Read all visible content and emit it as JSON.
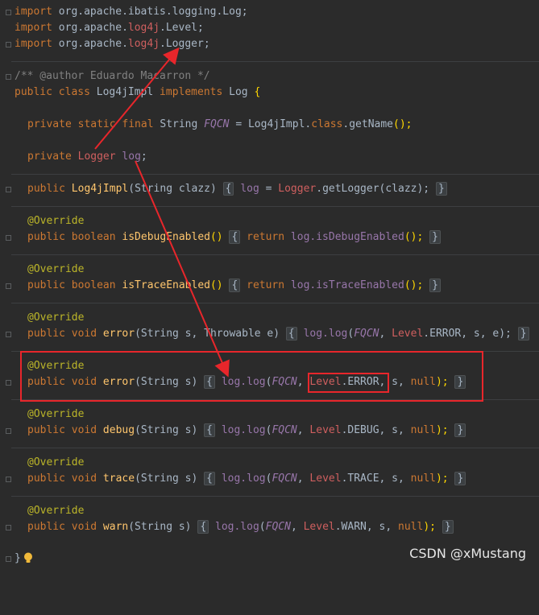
{
  "imports": [
    {
      "kw": "import",
      "pkg": "org.apache.ibatis.logging.",
      "cls": "Log",
      "red": "",
      "tail": ";"
    },
    {
      "kw": "import",
      "pkg": "org.apache.",
      "cls": "",
      "red": "log4j",
      "tail": ".Level;"
    },
    {
      "kw": "import",
      "pkg": "org.apache.",
      "cls": "",
      "red": "log4j",
      "tail": ".Logger;"
    }
  ],
  "comment": "/** @author Eduardo Macarron */",
  "class_decl": {
    "kw1": "public",
    "kw2": "class",
    "name": "Log4jImpl",
    "kw3": "implements",
    "iface": "Log",
    "brace": "{"
  },
  "field1": {
    "mods": "private static final",
    "type": "String",
    "name": "FQCN",
    "eq": "=",
    "value": "Log4jImpl.",
    "kwc": "class",
    "call": ".getName",
    "tail": "();"
  },
  "field2": {
    "mods": "private",
    "type": "Logger",
    "name": "log",
    "tail": ";"
  },
  "ctor": {
    "kw": "public",
    "name": "Log4jImpl",
    "params": "(String clazz)",
    "body_a": "log",
    "body_b": " = ",
    "body_c": "Logger",
    "body_d": ".getLogger(clazz);"
  },
  "annotation": "@Override",
  "methods": [
    {
      "sig_kw": "public boolean",
      "name": "isDebugEnabled",
      "params": "()",
      "ret": "return",
      "recv": "log.",
      "call": "isDebugEnabled",
      "tail": "();"
    },
    {
      "sig_kw": "public boolean",
      "name": "isTraceEnabled",
      "params": "()",
      "ret": "return",
      "recv": "log.",
      "call": "isTraceEnabled",
      "tail": "();"
    }
  ],
  "log_methods": [
    {
      "name": "error",
      "params": "(String s, Throwable e)",
      "fqcn": "FQCN",
      "lvl_cls": "Level",
      "lvl": ".ERROR",
      "args": ", s, e);"
    },
    {
      "name": "error",
      "params": "(String s)",
      "fqcn": "FQCN",
      "lvl_cls": "Level",
      "lvl": ".ERROR",
      "args": ", s, ",
      "nul": "null",
      "end": ");"
    },
    {
      "name": "debug",
      "params": "(String s)",
      "fqcn": "FQCN",
      "lvl_cls": "Level",
      "lvl": ".DEBUG",
      "args": ", s, ",
      "nul": "null",
      "end": ");"
    },
    {
      "name": "trace",
      "params": "(String s)",
      "fqcn": "FQCN",
      "lvl_cls": "Level",
      "lvl": ".TRACE",
      "args": ", s, ",
      "nul": "null",
      "end": ");"
    },
    {
      "name": "warn",
      "params": "(String s)",
      "fqcn": "FQCN",
      "lvl_cls": "Level",
      "lvl": ".WARN",
      "args": ", s, ",
      "nul": "null",
      "end": ");"
    }
  ],
  "public_void": "public void",
  "log_call": "log.log",
  "close_brace": "}",
  "open_brace": "{",
  "watermark": "CSDN @xMustang",
  "colors": {
    "annotation_box": "#e8262b",
    "arrow": "#e8262b",
    "background": "#2b2b2b"
  }
}
